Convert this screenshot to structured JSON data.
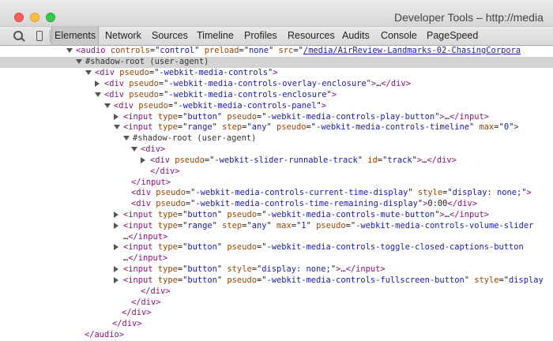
{
  "window": {
    "title": "Developer Tools – http://media"
  },
  "toolbar": {
    "tabs": [
      {
        "label": "Elements",
        "active": true
      },
      {
        "label": "Network"
      },
      {
        "label": "Sources"
      },
      {
        "label": "Timeline"
      },
      {
        "label": "Profiles"
      },
      {
        "label": "Resources"
      },
      {
        "label": "Audits"
      },
      {
        "label": "Console"
      },
      {
        "label": "PageSpeed"
      }
    ],
    "icons": [
      "search-icon",
      "device-icon"
    ]
  },
  "colors": {
    "tag": "#881280",
    "attr_name": "#994500",
    "attr_value": "#1a1aa6",
    "selected_row": "#d4d4d4"
  },
  "tree": [
    {
      "tri": "open",
      "segs": [
        [
          "tag",
          "<audio"
        ],
        [
          "tx",
          " "
        ],
        [
          "an",
          "controls"
        ],
        [
          "tx",
          "=\""
        ],
        [
          "av",
          "control"
        ],
        [
          "tx",
          "\" "
        ],
        [
          "an",
          "preload"
        ],
        [
          "tx",
          "=\""
        ],
        [
          "av",
          "none"
        ],
        [
          "tx",
          "\" "
        ],
        [
          "an",
          "src"
        ],
        [
          "tx",
          "=\""
        ],
        [
          "avl",
          "/media/AirReview-Landmarks-02-ChasingCorpora"
        ]
      ]
    },
    {
      "tri": "open",
      "hl": true,
      "segs": [
        [
          "sr",
          "#shadow-root (user-agent)"
        ]
      ]
    },
    {
      "tri": "open",
      "segs": [
        [
          "tag",
          "<div"
        ],
        [
          "tx",
          " "
        ],
        [
          "an",
          "pseudo"
        ],
        [
          "tx",
          "=\""
        ],
        [
          "av",
          "-webkit-media-controls"
        ],
        [
          "tx",
          "\""
        ],
        [
          "tag",
          ">"
        ]
      ]
    },
    {
      "tri": "closed",
      "segs": [
        [
          "tag",
          "<div"
        ],
        [
          "tx",
          " "
        ],
        [
          "an",
          "pseudo"
        ],
        [
          "tx",
          "=\""
        ],
        [
          "av",
          "-webkit-media-controls-overlay-enclosure"
        ],
        [
          "tx",
          "\""
        ],
        [
          "tag",
          ">"
        ],
        [
          "tx",
          "…"
        ],
        [
          "tag",
          "</div>"
        ]
      ]
    },
    {
      "tri": "open",
      "segs": [
        [
          "tag",
          "<div"
        ],
        [
          "tx",
          " "
        ],
        [
          "an",
          "pseudo"
        ],
        [
          "tx",
          "=\""
        ],
        [
          "av",
          "-webkit-media-controls-enclosure"
        ],
        [
          "tx",
          "\""
        ],
        [
          "tag",
          ">"
        ]
      ]
    },
    {
      "tri": "open",
      "segs": [
        [
          "tag",
          "<div"
        ],
        [
          "tx",
          " "
        ],
        [
          "an",
          "pseudo"
        ],
        [
          "tx",
          "=\""
        ],
        [
          "av",
          "-webkit-media-controls-panel"
        ],
        [
          "tx",
          "\""
        ],
        [
          "tag",
          ">"
        ]
      ]
    },
    {
      "tri": "closed",
      "segs": [
        [
          "tag",
          "<input"
        ],
        [
          "tx",
          " "
        ],
        [
          "an",
          "type"
        ],
        [
          "tx",
          "=\""
        ],
        [
          "av",
          "button"
        ],
        [
          "tx",
          "\" "
        ],
        [
          "an",
          "pseudo"
        ],
        [
          "tx",
          "=\""
        ],
        [
          "av",
          "-webkit-media-controls-play-button"
        ],
        [
          "tx",
          "\""
        ],
        [
          "tag",
          ">"
        ],
        [
          "tx",
          "…"
        ],
        [
          "tag",
          "</input>"
        ]
      ]
    },
    {
      "tri": "open",
      "segs": [
        [
          "tag",
          "<input"
        ],
        [
          "tx",
          " "
        ],
        [
          "an",
          "type"
        ],
        [
          "tx",
          "=\""
        ],
        [
          "av",
          "range"
        ],
        [
          "tx",
          "\" "
        ],
        [
          "an",
          "step"
        ],
        [
          "tx",
          "=\""
        ],
        [
          "av",
          "any"
        ],
        [
          "tx",
          "\" "
        ],
        [
          "an",
          "pseudo"
        ],
        [
          "tx",
          "=\""
        ],
        [
          "av",
          "-webkit-media-controls-timeline"
        ],
        [
          "tx",
          "\" "
        ],
        [
          "an",
          "max"
        ],
        [
          "tx",
          "=\""
        ],
        [
          "av",
          "0"
        ],
        [
          "tx",
          "\""
        ],
        [
          "tag",
          ">"
        ]
      ]
    },
    {
      "tri": "open",
      "segs": [
        [
          "sr",
          "#shadow-root (user-agent)"
        ]
      ]
    },
    {
      "tri": "open",
      "segs": [
        [
          "tag",
          "<div>"
        ]
      ]
    },
    {
      "tri": "closed",
      "segs": [
        [
          "tag",
          "<div"
        ],
        [
          "tx",
          " "
        ],
        [
          "an",
          "pseudo"
        ],
        [
          "tx",
          "=\""
        ],
        [
          "av",
          "-webkit-slider-runnable-track"
        ],
        [
          "tx",
          "\" "
        ],
        [
          "an",
          "id"
        ],
        [
          "tx",
          "=\""
        ],
        [
          "av",
          "track"
        ],
        [
          "tx",
          "\""
        ],
        [
          "tag",
          ">"
        ],
        [
          "tx",
          "…"
        ],
        [
          "tag",
          "</div>"
        ]
      ]
    },
    {
      "segs": [
        [
          "tag",
          "</div>"
        ]
      ]
    },
    {
      "segs": [
        [
          "tag",
          "</input>"
        ]
      ]
    },
    {
      "segs": [
        [
          "tag",
          "<div"
        ],
        [
          "tx",
          " "
        ],
        [
          "an",
          "pseudo"
        ],
        [
          "tx",
          "=\""
        ],
        [
          "av",
          "-webkit-media-controls-current-time-display"
        ],
        [
          "tx",
          "\" "
        ],
        [
          "an",
          "style"
        ],
        [
          "tx",
          "=\""
        ],
        [
          "av",
          "display: none;"
        ],
        [
          "tx",
          "\""
        ],
        [
          "tag",
          ">"
        ]
      ]
    },
    {
      "segs": [
        [
          "tag",
          "<div"
        ],
        [
          "tx",
          " "
        ],
        [
          "an",
          "pseudo"
        ],
        [
          "tx",
          "=\""
        ],
        [
          "av",
          "-webkit-media-controls-time-remaining-display"
        ],
        [
          "tx",
          "\""
        ],
        [
          "tag",
          ">"
        ],
        [
          "tx",
          "0:00"
        ],
        [
          "tag",
          "</div>"
        ]
      ]
    },
    {
      "tri": "closed",
      "segs": [
        [
          "tag",
          "<input"
        ],
        [
          "tx",
          " "
        ],
        [
          "an",
          "type"
        ],
        [
          "tx",
          "=\""
        ],
        [
          "av",
          "button"
        ],
        [
          "tx",
          "\" "
        ],
        [
          "an",
          "pseudo"
        ],
        [
          "tx",
          "=\""
        ],
        [
          "av",
          "-webkit-media-controls-mute-button"
        ],
        [
          "tx",
          "\""
        ],
        [
          "tag",
          ">"
        ],
        [
          "tx",
          "…"
        ],
        [
          "tag",
          "</input>"
        ]
      ]
    },
    {
      "tri": "closed",
      "segs": [
        [
          "tag",
          "<input"
        ],
        [
          "tx",
          " "
        ],
        [
          "an",
          "type"
        ],
        [
          "tx",
          "=\""
        ],
        [
          "av",
          "range"
        ],
        [
          "tx",
          "\" "
        ],
        [
          "an",
          "step"
        ],
        [
          "tx",
          "=\""
        ],
        [
          "av",
          "any"
        ],
        [
          "tx",
          "\" "
        ],
        [
          "an",
          "max"
        ],
        [
          "tx",
          "=\""
        ],
        [
          "av",
          "1"
        ],
        [
          "tx",
          "\" "
        ],
        [
          "an",
          "pseudo"
        ],
        [
          "tx",
          "=\""
        ],
        [
          "av",
          "-webkit-media-controls-volume-slider"
        ]
      ]
    },
    {
      "segs": [
        [
          "tx",
          "…"
        ],
        [
          "tag",
          "</input>"
        ]
      ]
    },
    {
      "tri": "closed",
      "segs": [
        [
          "tag",
          "<input"
        ],
        [
          "tx",
          " "
        ],
        [
          "an",
          "type"
        ],
        [
          "tx",
          "=\""
        ],
        [
          "av",
          "button"
        ],
        [
          "tx",
          "\" "
        ],
        [
          "an",
          "pseudo"
        ],
        [
          "tx",
          "=\""
        ],
        [
          "av",
          "-webkit-media-controls-toggle-closed-captions-button"
        ]
      ]
    },
    {
      "segs": [
        [
          "tx",
          "…"
        ],
        [
          "tag",
          "</input>"
        ]
      ]
    },
    {
      "tri": "closed",
      "segs": [
        [
          "tag",
          "<input"
        ],
        [
          "tx",
          " "
        ],
        [
          "an",
          "type"
        ],
        [
          "tx",
          "=\""
        ],
        [
          "av",
          "button"
        ],
        [
          "tx",
          "\" "
        ],
        [
          "an",
          "style"
        ],
        [
          "tx",
          "=\""
        ],
        [
          "av",
          "display: none;"
        ],
        [
          "tx",
          "\""
        ],
        [
          "tag",
          ">"
        ],
        [
          "tx",
          "…"
        ],
        [
          "tag",
          "</input>"
        ]
      ]
    },
    {
      "tri": "closed",
      "segs": [
        [
          "tag",
          "<input"
        ],
        [
          "tx",
          " "
        ],
        [
          "an",
          "type"
        ],
        [
          "tx",
          "=\""
        ],
        [
          "av",
          "button"
        ],
        [
          "tx",
          "\" "
        ],
        [
          "an",
          "pseudo"
        ],
        [
          "tx",
          "=\""
        ],
        [
          "av",
          "-webkit-media-controls-fullscreen-button"
        ],
        [
          "tx",
          "\" "
        ],
        [
          "an",
          "style"
        ],
        [
          "tx",
          "=\""
        ],
        [
          "av",
          "display"
        ]
      ]
    },
    {
      "segs": [
        [
          "tag",
          "</div>"
        ]
      ]
    },
    {
      "segs": [
        [
          "tag",
          "</div>"
        ]
      ]
    },
    {
      "segs": [
        [
          "tag",
          "</div>"
        ]
      ]
    },
    {
      "segs": [
        [
          "tag",
          "</div>"
        ]
      ]
    },
    {
      "segs": [
        [
          "tag",
          "</audio>"
        ]
      ]
    }
  ]
}
